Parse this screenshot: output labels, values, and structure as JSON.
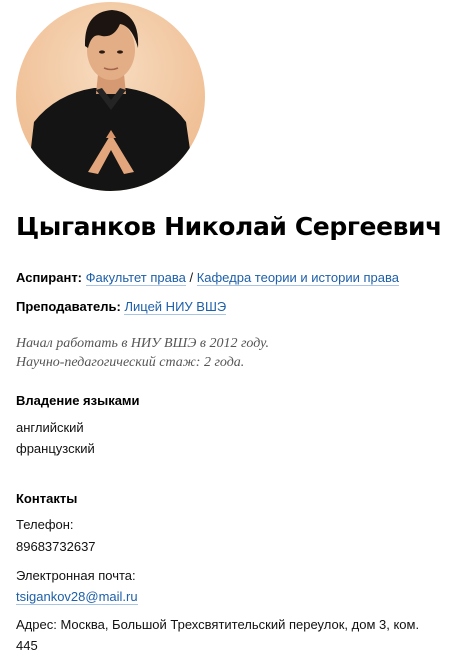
{
  "profile": {
    "name": "Цыганков Николай Сергеевич",
    "avatar_alt": "profile-photo"
  },
  "affiliations": {
    "aspirant_label": "Аспирант:",
    "faculty_link": "Факультет права",
    "separator": "/",
    "department_link": "Кафедра теории и истории права",
    "teacher_label": "Преподаватель:",
    "lyceum_link": "Лицей НИУ ВШЭ"
  },
  "experience": {
    "line1": "Начал работать в НИУ ВШЭ в 2012 году.",
    "line2": "Научно-педагогический стаж: 2 года."
  },
  "languages": {
    "title": "Владение языками",
    "items": [
      "английский",
      "французский"
    ]
  },
  "contacts": {
    "title": "Контакты",
    "phone_label": "Телефон:",
    "phone": "89683732637",
    "email_label": "Электронная почта:",
    "email": "tsigankov28@mail.ru",
    "address_line1": "Адрес: Москва, Большой Трехсвятительский переулок, дом 3, ком.",
    "address_line2": "445"
  },
  "colors": {
    "link": "#1d5fa9",
    "avatar_bg": "#f2c9a6"
  }
}
